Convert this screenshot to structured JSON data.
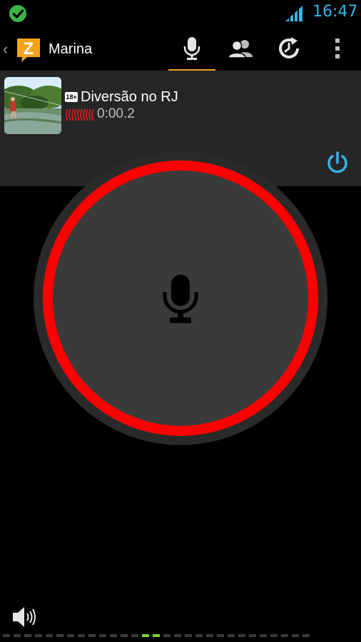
{
  "status_bar": {
    "time": "16:47",
    "check_icon": "check-circle-icon",
    "signal_icon": "signal-icon",
    "colors": {
      "time": "#33b5e5",
      "check": "#3bb54a"
    }
  },
  "action_bar": {
    "back_glyph": "‹",
    "logo_letter": "Z",
    "title": "Marina",
    "tabs": [
      {
        "name": "talk",
        "icon": "microphone-icon",
        "active": true
      },
      {
        "name": "contacts",
        "icon": "contacts-icon",
        "active": false
      },
      {
        "name": "history",
        "icon": "recents-icon",
        "active": false
      }
    ],
    "overflow_icon": "overflow-menu-icon",
    "accent": "#f7a21b"
  },
  "channel": {
    "age_badge": "18+",
    "name": "Diversão no RJ",
    "elapsed": "0:00.2",
    "power_icon": "power-icon"
  },
  "push_to_talk": {
    "icon": "microphone-icon",
    "ring_color": "#ff0000"
  },
  "footer": {
    "speaker_icon": "speaker-icon",
    "meter_segments": 29,
    "meter_active": [
      13,
      14
    ],
    "meter_color": "#7fd321"
  }
}
